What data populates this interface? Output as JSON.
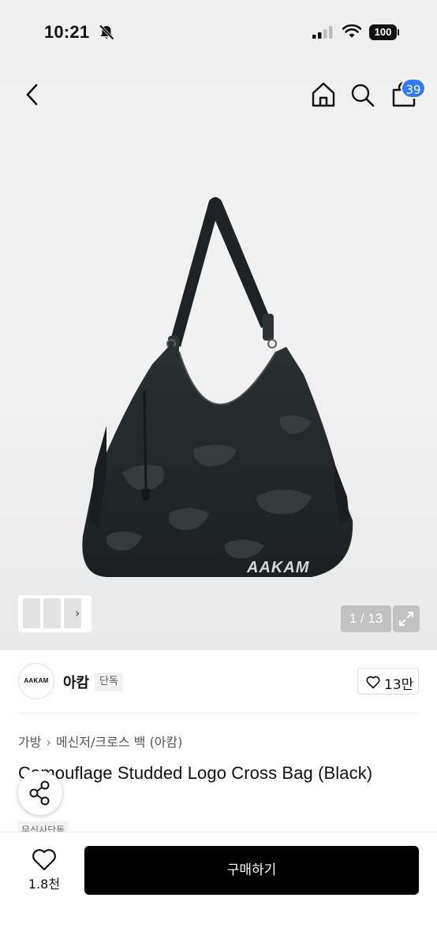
{
  "status_bar": {
    "time": "10:21",
    "battery": "100"
  },
  "header": {
    "cart_count": "39"
  },
  "gallery": {
    "counter": "1 / 13"
  },
  "brand": {
    "logo_text": "AAKAM",
    "name": "아캄",
    "exclusive_tag": "단독",
    "likes": "13만"
  },
  "breadcrumb": {
    "items": [
      "가방",
      "메신저/크로스 백 (아캄)"
    ]
  },
  "product": {
    "title": "Camouflage Studded Logo Cross Bag (Black)",
    "tag": "무신사단독",
    "bag_logo": "AAKAM"
  },
  "bottom_bar": {
    "favorites": "1.8천",
    "buy_label": "구매하기"
  },
  "colors": {
    "badge": "#2f7bf6",
    "buy_button": "#000000"
  }
}
